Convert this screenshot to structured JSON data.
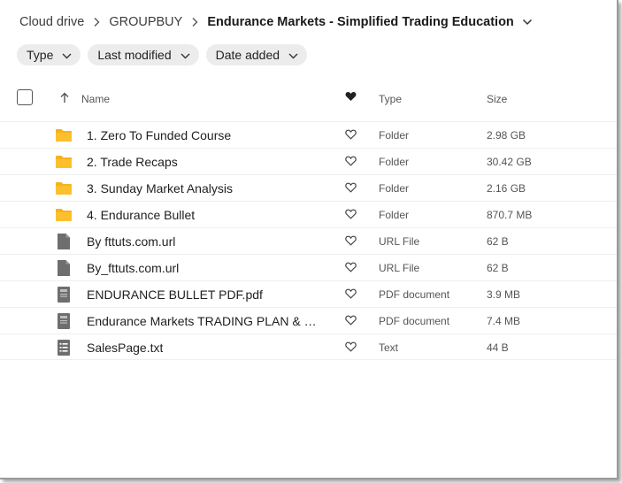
{
  "breadcrumb": {
    "items": [
      "Cloud drive",
      "GROUPBUY",
      "Endurance Markets - Simplified Trading Education"
    ]
  },
  "filters": [
    {
      "label": "Type"
    },
    {
      "label": "Last modified"
    },
    {
      "label": "Date added"
    }
  ],
  "columns": {
    "name": "Name",
    "type": "Type",
    "size": "Size"
  },
  "files": [
    {
      "name": "1. Zero To Funded Course",
      "type": "Folder",
      "size": "2.98 GB",
      "icon": "folder-icon"
    },
    {
      "name": "2. Trade Recaps",
      "type": "Folder",
      "size": "30.42 GB",
      "icon": "folder-icon"
    },
    {
      "name": "3. Sunday Market Analysis",
      "type": "Folder",
      "size": "2.16 GB",
      "icon": "folder-icon"
    },
    {
      "name": "4. Endurance Bullet",
      "type": "Folder",
      "size": "870.7 MB",
      "icon": "folder-icon"
    },
    {
      "name": "By fttuts.com.url",
      "type": "URL File",
      "size": "62 B",
      "icon": "url-file-icon"
    },
    {
      "name": "By_fttuts.com.url",
      "type": "URL File",
      "size": "62 B",
      "icon": "url-file-icon"
    },
    {
      "name": "ENDURANCE BULLET PDF.pdf",
      "type": "PDF document",
      "size": "3.9 MB",
      "icon": "pdf-file-icon"
    },
    {
      "name": "Endurance Markets TRADING PLAN & GU...",
      "type": "PDF document",
      "size": "7.4 MB",
      "icon": "pdf-file-icon"
    },
    {
      "name": "SalesPage.txt",
      "type": "Text",
      "size": "44 B",
      "icon": "text-file-icon"
    }
  ],
  "colors": {
    "folder": "#f7b21b",
    "file_gray": "#6e6e6e",
    "chip_bg": "#ececec"
  }
}
